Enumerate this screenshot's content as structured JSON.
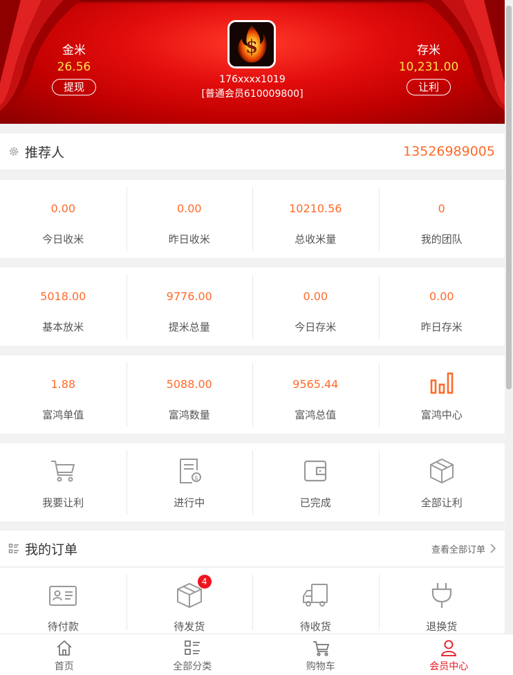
{
  "header": {
    "left_balance": {
      "label": "金米",
      "value": "26.56",
      "button": "提现"
    },
    "right_balance": {
      "label": "存米",
      "value": "10,231.00",
      "button": "让利"
    },
    "user": {
      "phone": "176xxxx1019",
      "level": "[普通会员610009800]"
    }
  },
  "referrer": {
    "label": "推荐人",
    "value": "13526989005"
  },
  "stats_row1": [
    {
      "value": "0.00",
      "label": "今日收米"
    },
    {
      "value": "0.00",
      "label": "昨日收米"
    },
    {
      "value": "10210.56",
      "label": "总收米量"
    },
    {
      "value": "0",
      "label": "我的团队"
    }
  ],
  "stats_row2": [
    {
      "value": "5018.00",
      "label": "基本放米"
    },
    {
      "value": "9776.00",
      "label": "提米总量"
    },
    {
      "value": "0.00",
      "label": "今日存米"
    },
    {
      "value": "0.00",
      "label": "昨日存米"
    }
  ],
  "stats_row3": [
    {
      "value": "1.88",
      "label": "富鸿单值"
    },
    {
      "value": "5088.00",
      "label": "富鸿数量"
    },
    {
      "value": "9565.44",
      "label": "富鸿总值"
    },
    {
      "label": "富鸿中心",
      "icon": "bar-chart-icon"
    }
  ],
  "actions": [
    {
      "label": "我要让利",
      "icon": "cart-icon"
    },
    {
      "label": "进行中",
      "icon": "invoice-icon"
    },
    {
      "label": "已完成",
      "icon": "wallet-icon"
    },
    {
      "label": "全部让利",
      "icon": "box-icon"
    }
  ],
  "orders": {
    "title": "我的订单",
    "view_all": "查看全部订单",
    "items": [
      {
        "label": "待付款",
        "icon": "id-card-icon"
      },
      {
        "label": "待发货",
        "icon": "package-icon",
        "badge": "4"
      },
      {
        "label": "待收货",
        "icon": "truck-icon"
      },
      {
        "label": "退换货",
        "icon": "plug-icon"
      }
    ]
  },
  "tabbar": [
    {
      "label": "首页",
      "icon": "home-icon"
    },
    {
      "label": "全部分类",
      "icon": "category-icon"
    },
    {
      "label": "购物车",
      "icon": "cart-icon"
    },
    {
      "label": "会员中心",
      "icon": "user-icon",
      "active": true
    }
  ],
  "colors": {
    "accent": "#ff6a2a",
    "active_tab": "#e8141e",
    "header_red": "#e30d0d",
    "gold": "#ffe14a"
  }
}
